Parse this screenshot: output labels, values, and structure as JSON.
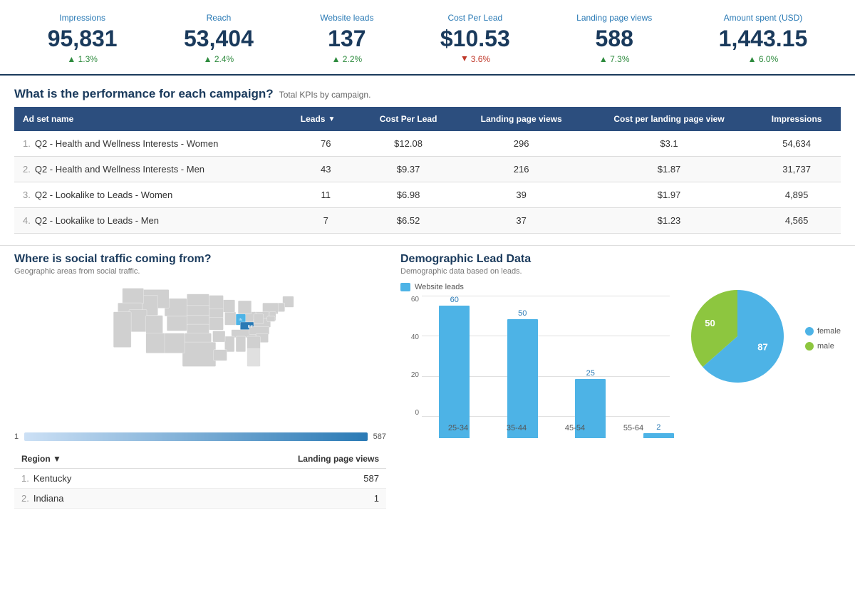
{
  "kpis": [
    {
      "label": "Impressions",
      "value": "95,831",
      "change": "1.3%",
      "direction": "up"
    },
    {
      "label": "Reach",
      "value": "53,404",
      "change": "2.4%",
      "direction": "up"
    },
    {
      "label": "Website leads",
      "value": "137",
      "change": "2.2%",
      "direction": "up"
    },
    {
      "label": "Cost Per Lead",
      "value": "$10.53",
      "change": "3.6%",
      "direction": "down"
    },
    {
      "label": "Landing page views",
      "value": "588",
      "change": "7.3%",
      "direction": "up"
    },
    {
      "label": "Amount spent (USD)",
      "value": "1,443.15",
      "change": "6.0%",
      "direction": "up"
    }
  ],
  "campaign_section": {
    "title": "What is the performance for each campaign?",
    "subtitle": "Total KPIs by campaign.",
    "columns": [
      "Ad set name",
      "Leads",
      "Cost Per Lead",
      "Landing page views",
      "Cost per landing page view",
      "Impressions"
    ],
    "rows": [
      {
        "num": "1.",
        "name": "Q2 - Health and Wellness Interests - Women",
        "leads": "76",
        "cpl": "$12.08",
        "lpv": "296",
        "cplpv": "$3.1",
        "impressions": "54,634"
      },
      {
        "num": "2.",
        "name": "Q2 - Health and Wellness Interests - Men",
        "leads": "43",
        "cpl": "$9.37",
        "lpv": "216",
        "cplpv": "$1.87",
        "impressions": "31,737"
      },
      {
        "num": "3.",
        "name": "Q2 - Lookalike to Leads - Women",
        "leads": "11",
        "cpl": "$6.98",
        "lpv": "39",
        "cplpv": "$1.97",
        "impressions": "4,895"
      },
      {
        "num": "4.",
        "name": "Q2 - Lookalike to Leads - Men",
        "leads": "7",
        "cpl": "$6.52",
        "lpv": "37",
        "cplpv": "$1.23",
        "impressions": "4,565"
      }
    ]
  },
  "traffic_section": {
    "title": "Where is social traffic coming from?",
    "subtitle": "Geographic areas from social traffic.",
    "scale_min": "1",
    "scale_max": "587",
    "region_columns": [
      "Region",
      "Landing page views"
    ],
    "regions": [
      {
        "num": "1.",
        "name": "Kentucky",
        "value": "587"
      },
      {
        "num": "2.",
        "name": "Indiana",
        "value": "1"
      }
    ]
  },
  "demo_section": {
    "title": "Demographic Lead Data",
    "subtitle": "Demographic data based on leads.",
    "chart_legend": "Website leads",
    "bars": [
      {
        "label": "25-34",
        "value": 60,
        "display": "60"
      },
      {
        "label": "35-44",
        "value": 50,
        "display": "50"
      },
      {
        "label": "45-54",
        "value": 25,
        "display": "25"
      },
      {
        "label": "55-64",
        "value": 2,
        "display": "2"
      }
    ],
    "y_labels": [
      "60",
      "40",
      "20",
      "0"
    ],
    "pie": {
      "female_value": 87,
      "male_value": 50,
      "female_label": "female",
      "male_label": "male",
      "female_color": "#4db3e6",
      "male_color": "#8dc63f"
    }
  }
}
